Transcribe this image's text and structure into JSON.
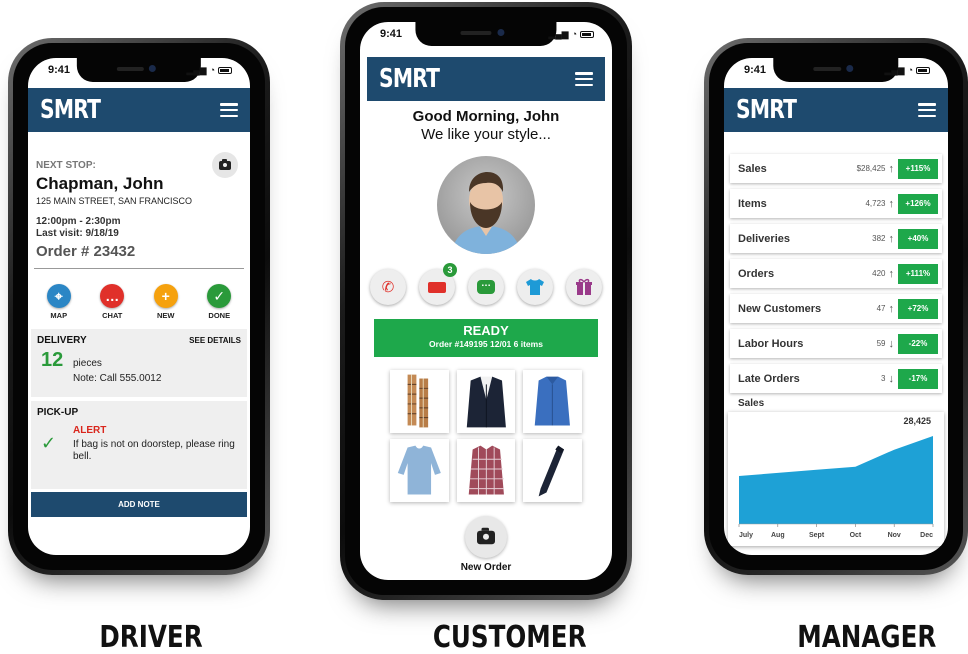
{
  "status_time": "9:41",
  "app_logo": "SMRT",
  "driver": {
    "next_stop_label": "NEXT STOP:",
    "customer_name": "Chapman, John",
    "address": "125 MAIN STREET, SAN FRANCISCO",
    "time_window": "12:00pm - 2:30pm",
    "last_visit": "Last visit: 9/18/19",
    "order_number": "Order # 23432",
    "actions": [
      {
        "label": "MAP",
        "icon": "map-pin-icon",
        "color": "#2b86c5"
      },
      {
        "label": "CHAT",
        "icon": "chat-icon",
        "color": "#e0302a"
      },
      {
        "label": "NEW",
        "icon": "plus-icon",
        "color": "#f5a10e"
      },
      {
        "label": "DONE",
        "icon": "check-icon",
        "color": "#2a9a3a"
      }
    ],
    "delivery": {
      "title": "DELIVERY",
      "details_link": "SEE DETAILS",
      "count": "12",
      "unit": "pieces",
      "note": "Note: Call 555.0012"
    },
    "pickup": {
      "title": "PICK-UP",
      "alert_label": "ALERT",
      "alert_text": "If bag is not on doorstep, please ring bell."
    },
    "add_note_label": "ADD NOTE"
  },
  "customer": {
    "greeting": "Good Morning, John",
    "tagline": "We like your style...",
    "actions": [
      {
        "icon": "phone-icon",
        "color": "#e0302a"
      },
      {
        "icon": "delivery-truck-icon",
        "color": "#e0302a",
        "badge": "3"
      },
      {
        "icon": "chat-icon",
        "color": "#2a9a3a"
      },
      {
        "icon": "shirt-icon",
        "color": "#1e9ad6"
      },
      {
        "icon": "gift-icon",
        "color": "#9a3a8a"
      }
    ],
    "ready_title": "READY",
    "ready_subtitle": "Order #149195 12/01 6 items",
    "items": [
      "plaid-scarf",
      "navy-blazer",
      "blue-dress-shirt",
      "light-blue-sweater",
      "plaid-shirt",
      "navy-tie"
    ],
    "new_order_label": "New Order"
  },
  "manager": {
    "metrics": [
      {
        "label": "Sales",
        "value": "$28,425",
        "trend": "up",
        "change": "+115%"
      },
      {
        "label": "Items",
        "value": "4,723",
        "trend": "up",
        "change": "+126%"
      },
      {
        "label": "Deliveries",
        "value": "382",
        "trend": "up",
        "change": "+40%"
      },
      {
        "label": "Orders",
        "value": "420",
        "trend": "up",
        "change": "+111%"
      },
      {
        "label": "New Customers",
        "value": "47",
        "trend": "up",
        "change": "+72%"
      },
      {
        "label": "Labor Hours",
        "value": "59",
        "trend": "down",
        "change": "-22%"
      },
      {
        "label": "Late Orders",
        "value": "3",
        "trend": "down",
        "change": "-17%"
      }
    ],
    "chart_title": "Sales",
    "chart_data": {
      "type": "area",
      "title": "Sales",
      "categories": [
        "July",
        "Aug",
        "Sept",
        "Oct",
        "Nov",
        "Dec"
      ],
      "values": [
        15500,
        16500,
        17500,
        18500,
        24000,
        28425
      ],
      "ylim": [
        0,
        31000
      ],
      "annotation": "28,425",
      "color": "#1ea1d6"
    }
  },
  "labels": {
    "driver": "DRIVER",
    "customer": "CUSTOMER",
    "manager": "MANAGER"
  }
}
